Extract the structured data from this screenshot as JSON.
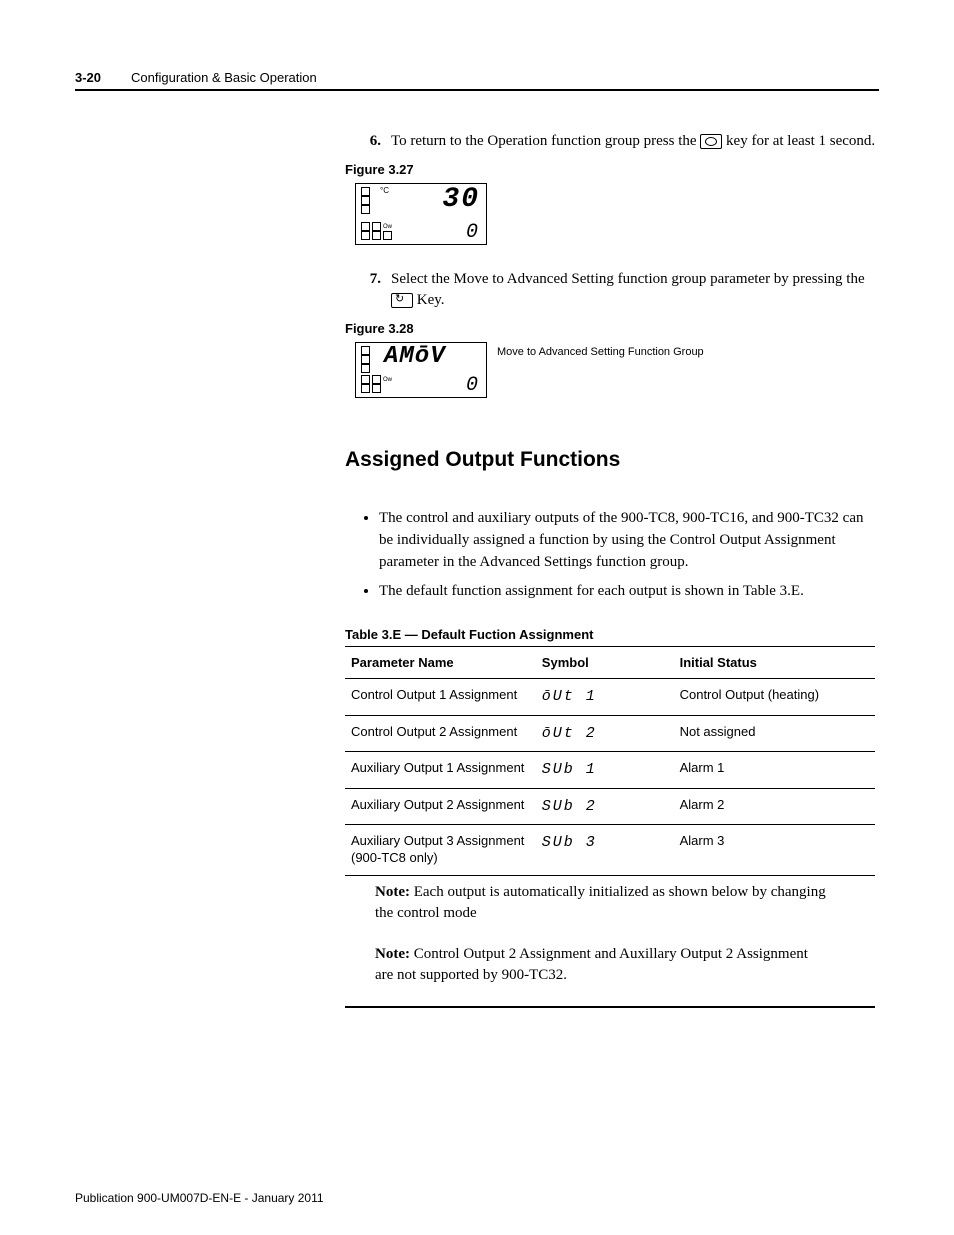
{
  "header": {
    "page_number": "3-20",
    "chapter_title": "Configuration & Basic Operation"
  },
  "step6": {
    "number": "6.",
    "text_before_key": "To return to the Operation function group press the ",
    "text_after_key": " key for at least 1 second."
  },
  "figure327": {
    "label": "Figure 3.27",
    "top_unit": "°C",
    "top_value": "30",
    "bottom_value": "0"
  },
  "step7": {
    "number": "7.",
    "text_before_key": "Select the Move to Advanced Setting function group parameter by pressing the ",
    "text_after_key": " Key."
  },
  "figure328": {
    "label": "Figure 3.28",
    "display_text": "AMōV",
    "bottom_value": "0",
    "caption": "Move to Advanced Setting Function Group"
  },
  "section_heading": "Assigned Output Functions",
  "bullets": [
    "The control and auxiliary outputs of the 900-TC8, 900-TC16, and 900-TC32 can be individually assigned a function by using the Control Output Assignment parameter in the Advanced Settings function group.",
    "The default function assignment for each output is shown in Table 3.E."
  ],
  "table": {
    "label": "Table 3.E — Default Fuction Assignment",
    "headers": [
      "Parameter Name",
      "Symbol",
      "Initial Status"
    ],
    "rows": [
      {
        "name": "Control Output 1 Assignment",
        "symbol": "ōUt  1",
        "status": "Control Output (heating)"
      },
      {
        "name": "Control Output 2 Assignment",
        "symbol": "ōUt  2",
        "status": "Not assigned"
      },
      {
        "name": "Auxiliary Output 1 Assignment",
        "symbol": "SUb  1",
        "status": "Alarm 1"
      },
      {
        "name": "Auxiliary Output 2 Assignment",
        "symbol": "SUb  2",
        "status": "Alarm 2"
      },
      {
        "name": "Auxiliary Output 3 Assignment (900-TC8 only)",
        "symbol": "SUb  3",
        "status": "Alarm 3"
      }
    ]
  },
  "note1": {
    "label": "Note:",
    "text": "Each output is automatically initialized as shown below by changing the control mode"
  },
  "note2": {
    "label": "Note:",
    "text": "Control Output 2 Assignment and Auxillary Output 2 Assignment are not supported by 900-TC32."
  },
  "footer": "Publication 900-UM007D-EN-E - January 2011"
}
